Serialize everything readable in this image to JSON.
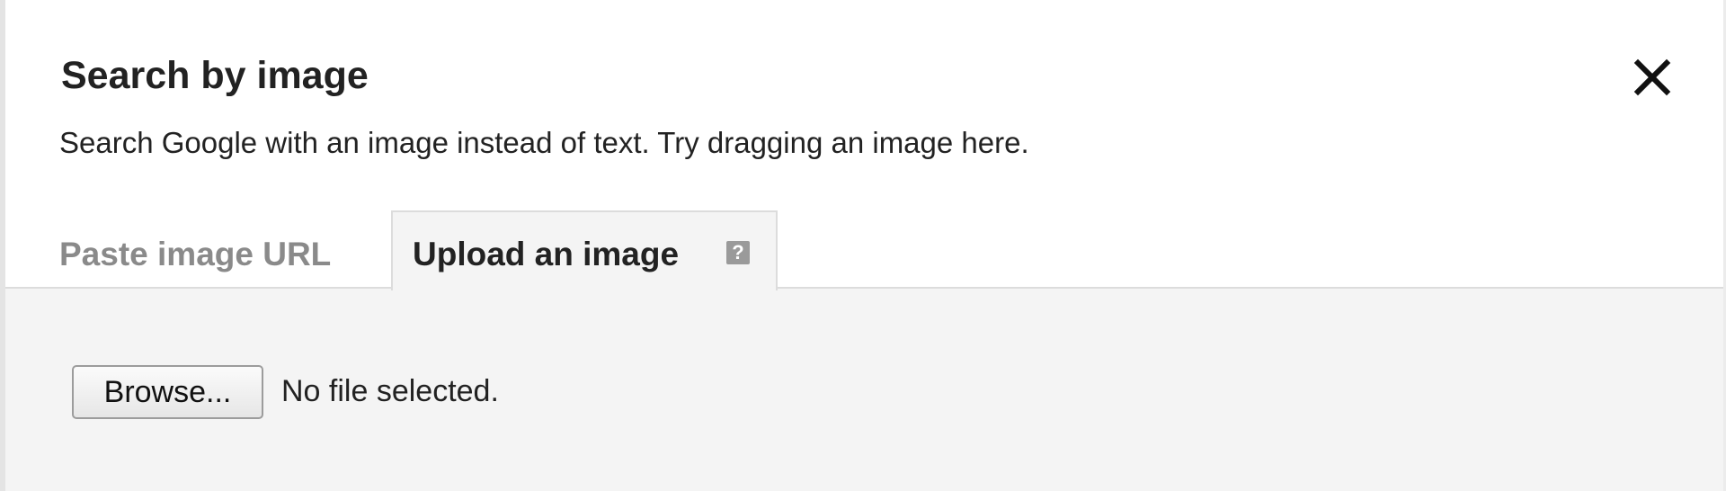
{
  "dialog": {
    "title": "Search by image",
    "subtitle": "Search Google with an image instead of text. Try dragging an image here.",
    "close_icon": "close-icon"
  },
  "tabs": [
    {
      "label": "Paste image URL",
      "active": false
    },
    {
      "label": "Upload an image",
      "active": true,
      "icon": "help-icon",
      "icon_glyph": "?"
    }
  ],
  "upload": {
    "browse_label": "Browse...",
    "file_status": "No file selected."
  },
  "colors": {
    "content_background": "#f4f4f4",
    "inactive_tab_text": "#8a8a8a",
    "active_tab_text": "#222222"
  }
}
